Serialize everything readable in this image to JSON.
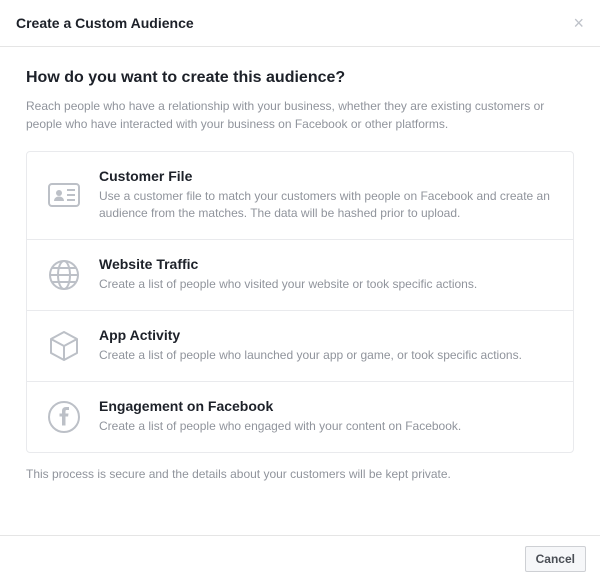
{
  "header": {
    "title": "Create a Custom Audience"
  },
  "body": {
    "question": "How do you want to create this audience?",
    "intro": "Reach people who have a relationship with your business, whether they are existing customers or people who have interacted with your business on Facebook or other platforms.",
    "options": [
      {
        "title": "Customer File",
        "desc": "Use a customer file to match your customers with people on Facebook and create an audience from the matches. The data will be hashed prior to upload."
      },
      {
        "title": "Website Traffic",
        "desc": "Create a list of people who visited your website or took specific actions."
      },
      {
        "title": "App Activity",
        "desc": "Create a list of people who launched your app or game, or took specific actions."
      },
      {
        "title": "Engagement on Facebook",
        "desc": "Create a list of people who engaged with your content on Facebook."
      }
    ],
    "footnote": "This process is secure and the details about your customers will be kept private."
  },
  "footer": {
    "cancel": "Cancel"
  }
}
